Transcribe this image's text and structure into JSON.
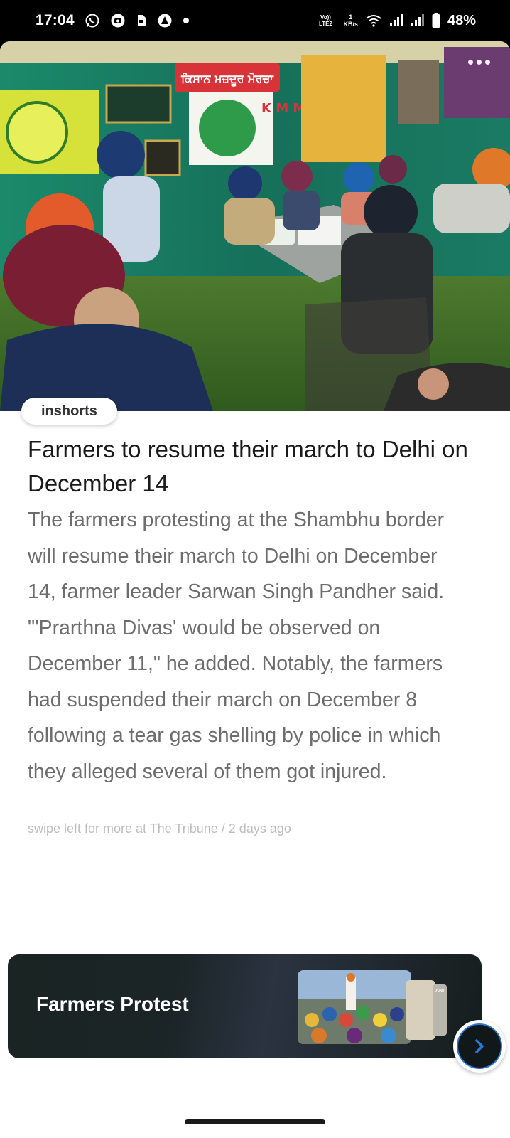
{
  "status_bar": {
    "time": "17:04",
    "net_top": "Vo)) LTE2",
    "speed_value": "1",
    "speed_unit": "KB/s",
    "battery": "48%",
    "left_icons": [
      "whatsapp-icon",
      "camera-icon",
      "sim-icon",
      "alert-icon",
      "dot-icon"
    ],
    "right_icons": [
      "wifi-icon",
      "signal-icon",
      "signal-icon-2",
      "battery-icon"
    ]
  },
  "article": {
    "source": "inshorts",
    "headline": "Farmers to resume their march to Delhi on December 14",
    "body": "The farmers protesting at the Shambhu border will resume their march to Delhi on December 14, farmer leader Sarwan Singh Pandher said. \"'Prarthna Divas' would be observed on December 11,\" he added. Notably, the farmers had suspended their march on December 8 following a tear gas shelling by police in which they alleged several of them got injured.",
    "footer": "swipe left for more at The Tribune / 2 days ago",
    "more_icon": "more-horizontal-icon"
  },
  "hero_signs": {
    "banner_text": "ਕਿਸਾਨ ਮਜ਼ਦੂਰ ਮੋਰਚਾ",
    "kmm_letters": "K M M"
  },
  "banner": {
    "title": "Farmers Protest",
    "thumb_label": "ANI",
    "next_icon": "chevron-right-icon"
  },
  "colors": {
    "accent_blue": "#2a77d6",
    "banner_bg": "#1b2527",
    "headline": "#1a1a1a",
    "body": "#6d6d6d",
    "meta": "#bdbdbd"
  }
}
